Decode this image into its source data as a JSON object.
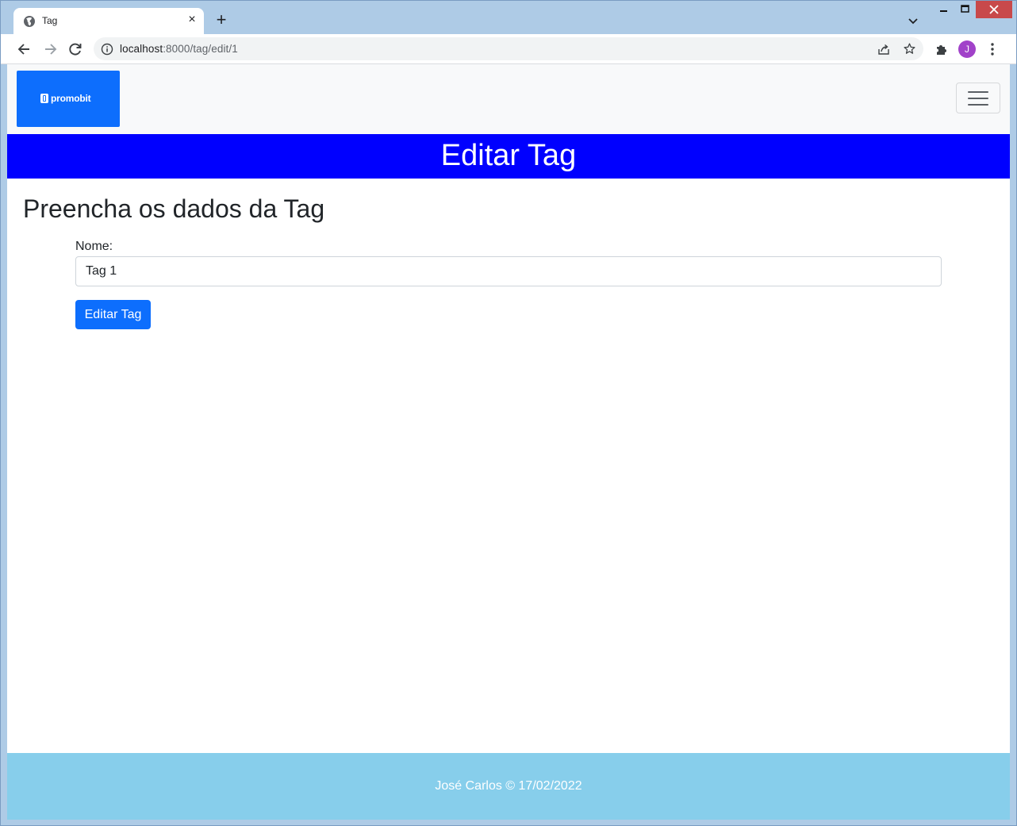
{
  "browser": {
    "tab": {
      "title": "Tag",
      "close_glyph": "×"
    },
    "new_tab_glyph": "+",
    "address_bar": {
      "host": "localhost",
      "path": ":8000/tag/edit/1"
    },
    "profile_initial": "J",
    "icons": {
      "favicon": "globe-icon",
      "back": "arrow-left-icon",
      "forward": "arrow-right-icon",
      "reload": "reload-icon",
      "site_info": "info-icon",
      "share": "share-icon",
      "bookmark": "star-icon",
      "extensions": "puzzle-icon",
      "menu": "kebab-menu-icon",
      "tab_search": "chevron-down-icon"
    }
  },
  "navbar": {
    "brand_text": "promobit",
    "brand_color": "#0d6efd"
  },
  "banner": {
    "title": "Editar Tag",
    "color": "#0000ff"
  },
  "main": {
    "heading": "Preencha os dados da Tag",
    "form": {
      "name_label": "Nome:",
      "name_value": "Tag 1",
      "submit_label": "Editar Tag"
    }
  },
  "footer": {
    "text": "José Carlos © 17/02/2022",
    "color": "#87ceeb"
  }
}
